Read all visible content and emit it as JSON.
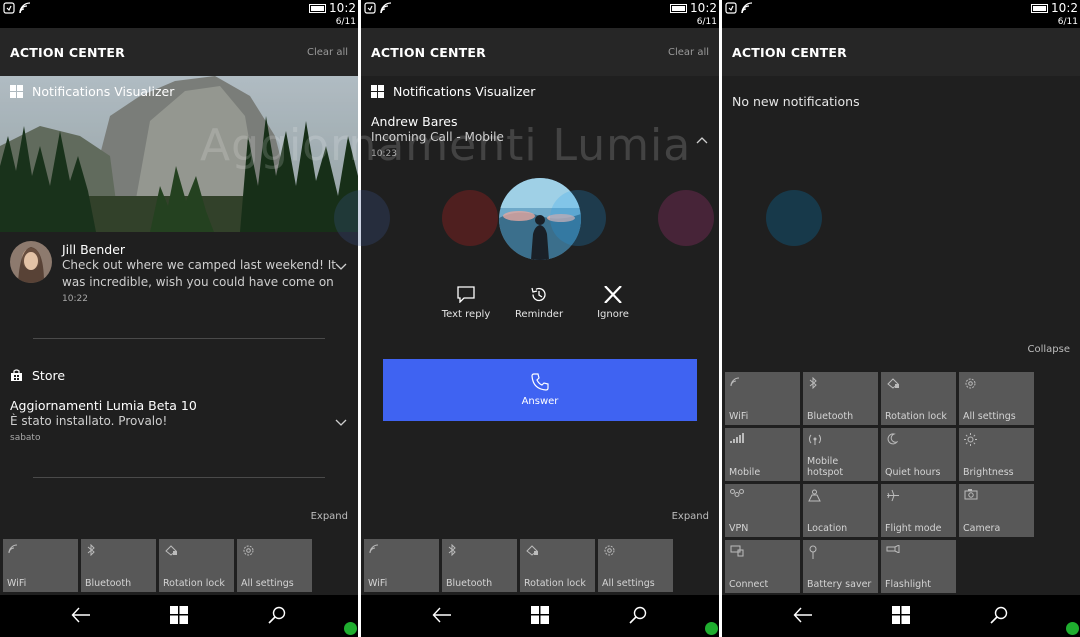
{
  "colors": {
    "accent": "#3f63f2",
    "tile": "#585858",
    "panel": "#1f1f1f",
    "header": "#262626"
  },
  "screens": [
    {
      "status": {
        "time": "10:2",
        "date": "6/11"
      },
      "header": {
        "title": "ACTION CENTER",
        "clear_all": "Clear all"
      },
      "group1": {
        "app": "Notifications Visualizer",
        "notif": {
          "title": "Jill Bender",
          "body_line1": "Check out where we camped last weekend! It",
          "body_line2": "was incredible, wish you could have come on",
          "time": "10:22"
        }
      },
      "group2": {
        "app": "Store",
        "notif": {
          "title": "Aggiornamenti Lumia Beta 10",
          "body": "È stato installato. Provalo!",
          "time": "sabato"
        }
      },
      "expand": "Expand",
      "tiles": [
        "WiFi",
        "Bluetooth",
        "Rotation lock",
        "All settings"
      ]
    },
    {
      "status": {
        "time": "10:2",
        "date": "6/11"
      },
      "header": {
        "title": "ACTION CENTER",
        "clear_all": "Clear all"
      },
      "app": "Notifications Visualizer",
      "call": {
        "caller": "Andrew Bares",
        "subtitle": "Incoming Call - Mobile",
        "time": "10:23",
        "actions": [
          "Text reply",
          "Reminder",
          "Ignore"
        ],
        "answer": "Answer"
      },
      "expand": "Expand",
      "tiles": [
        "WiFi",
        "Bluetooth",
        "Rotation lock",
        "All settings"
      ]
    },
    {
      "status": {
        "time": "10:2",
        "date": "6/11"
      },
      "header": {
        "title": "ACTION CENTER"
      },
      "empty": "No new notifications",
      "collapse": "Collapse",
      "tiles": [
        "WiFi",
        "Bluetooth",
        "Rotation lock",
        "All settings",
        "Mobile",
        "Mobile hotspot",
        "Quiet hours",
        "Brightness",
        "VPN",
        "Location",
        "Flight mode",
        "Camera",
        "Connect",
        "Battery saver",
        "Flashlight"
      ]
    }
  ],
  "watermark": "Aggiornamenti Lumia"
}
